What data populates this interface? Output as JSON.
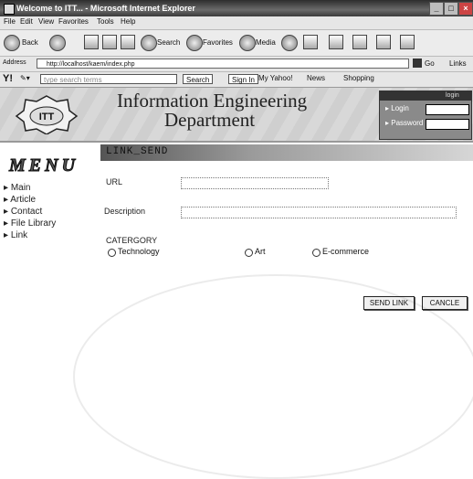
{
  "window": {
    "title": "Welcome to ITT... - Microsoft Internet Explorer"
  },
  "menubar": [
    "File",
    "Edit",
    "View",
    "Favorites",
    "Tools",
    "Help"
  ],
  "toolbar": {
    "back_label": "Back",
    "search_label": "Search",
    "favorites_label": "Favorites",
    "media_label": "Media"
  },
  "address": {
    "label": "Address",
    "url": "http://localhost/kaem/index.php",
    "go_label": "Go",
    "links_label": "Links"
  },
  "yahoo_bar": {
    "search_placeholder": "type search terms",
    "search_button": "Search",
    "signin_button": "Sign In",
    "my_yahoo": "My Yahoo!",
    "news": "News",
    "shopping": "Shopping"
  },
  "banner": {
    "logo_text": "ITT",
    "title_line1": "Information Engineering",
    "title_line2": "Department"
  },
  "login": {
    "login_label": "Login",
    "password_label": "Password",
    "button": "login"
  },
  "sidebar": {
    "title": "MENU",
    "items": [
      "Main",
      "Article",
      "Contact",
      "File Library",
      "Link"
    ]
  },
  "main": {
    "section_title": "LINK_SEND",
    "url_label": "URL",
    "description_label": "Description",
    "category_label": "CATERGORY",
    "categories": [
      "Technology",
      "Art",
      "E-commerce"
    ],
    "send_button": "SEND LINK",
    "cancel_button": "CANCLE"
  }
}
